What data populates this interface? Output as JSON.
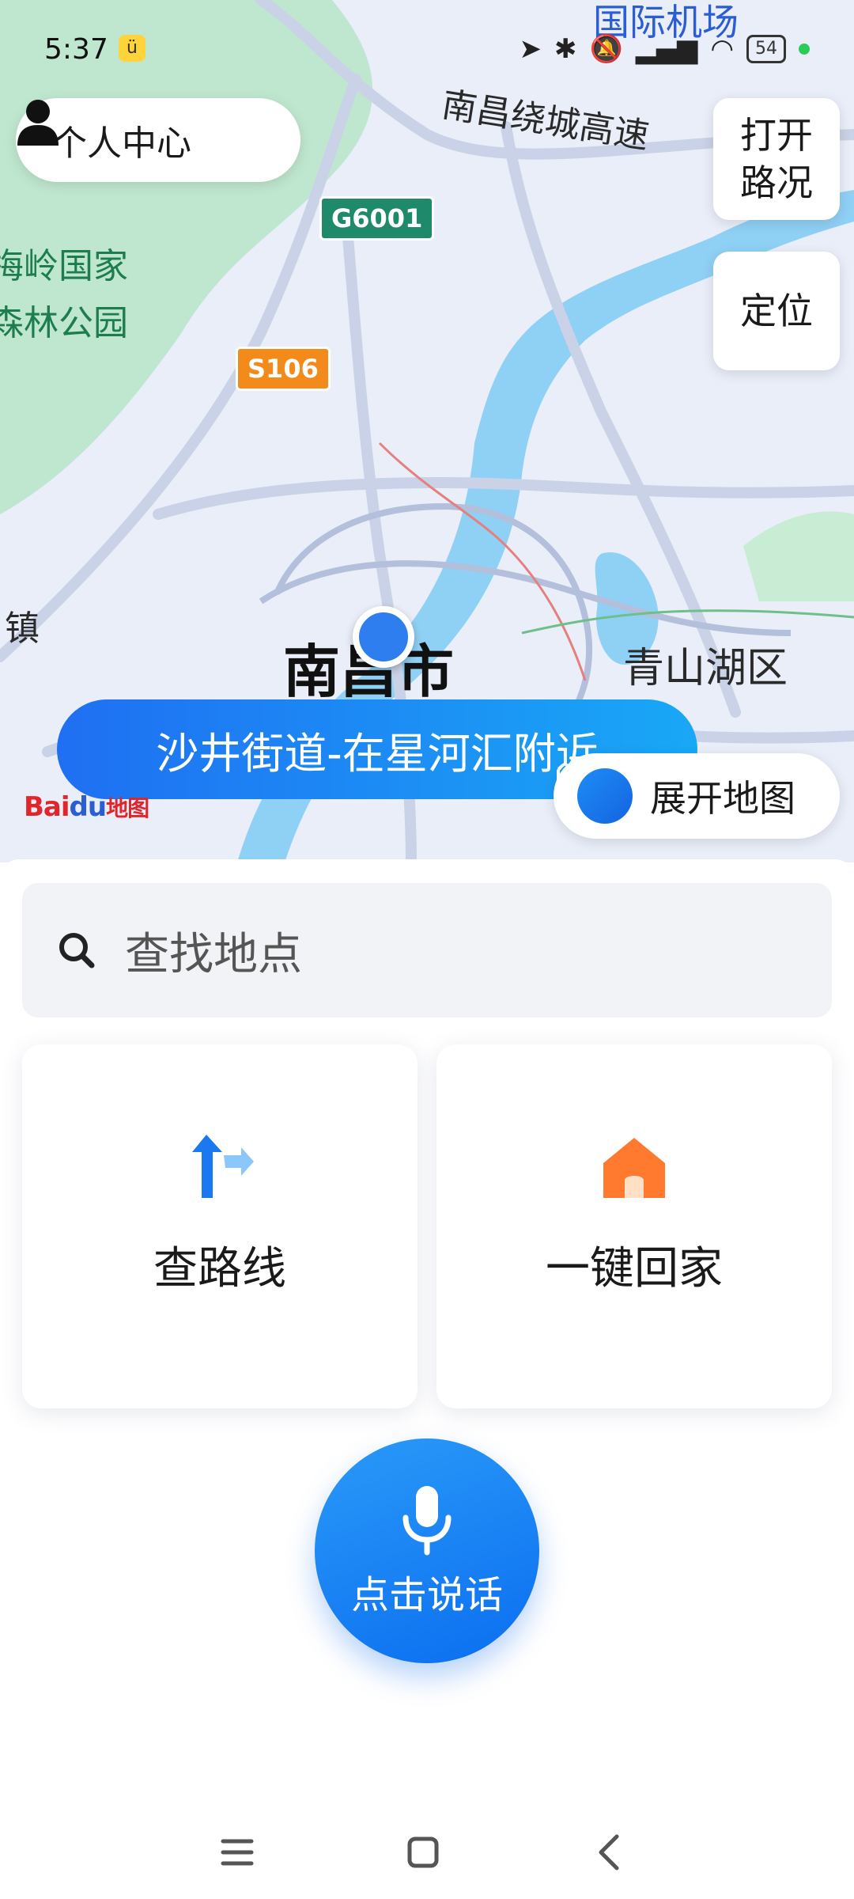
{
  "status_bar": {
    "time": "5:37",
    "app_icon": "bunny-icon",
    "battery": "54",
    "icons": [
      "location-arrow-icon",
      "bluetooth-icon",
      "mute-bell-icon",
      "signal-icon",
      "wifi-icon",
      "battery-icon",
      "green-dot-icon"
    ]
  },
  "map": {
    "user_center_label": "个人中心",
    "traffic_button": "打开\n路况",
    "locate_button": "定位",
    "labels": {
      "airport": "国际机场",
      "ring_highway": "南昌绕城高速",
      "park_line1": "梅岭国家",
      "park_line2": "森林公园",
      "town": "镇",
      "city": "南昌市",
      "district": "青山湖区"
    },
    "road_shields": {
      "g6001": "G6001",
      "s106": "S106"
    },
    "location_banner": "沙井街道-在星河汇附近",
    "expand_button": "展开地图",
    "logo_bai": "Bai",
    "logo_du": "du",
    "logo_map": "地图",
    "colors": {
      "water": "#8fd0f5",
      "park": "#bfe7cf",
      "road": "#c9d2e6",
      "accent": "#1b7cf3"
    }
  },
  "panel": {
    "search_placeholder": "查找地点",
    "route_card_label": "查路线",
    "home_card_label": "一键回家",
    "voice_button_label": "点击说话"
  },
  "nav": {
    "icons": [
      "menu-icon",
      "home-square-icon",
      "back-icon"
    ]
  }
}
